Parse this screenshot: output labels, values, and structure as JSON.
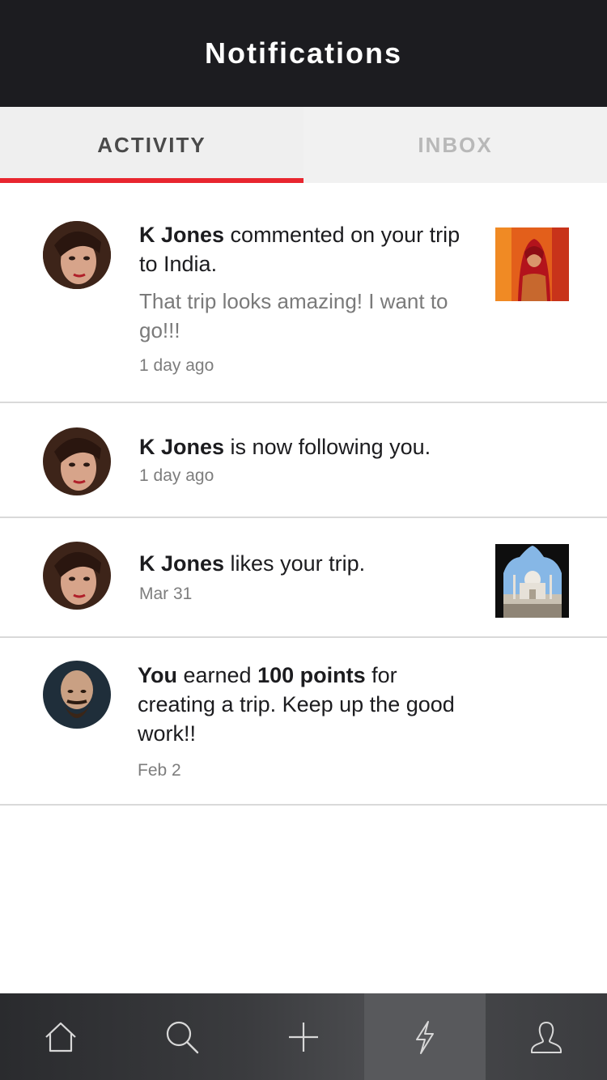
{
  "header": {
    "title": "Notifications"
  },
  "tabs": [
    {
      "label": "ACTIVITY",
      "active": true
    },
    {
      "label": "INBOX",
      "active": false
    }
  ],
  "accent_color": "#e8262f",
  "notifications": [
    {
      "actor": "K Jones",
      "action": " commented on your trip to India.",
      "comment": "That trip looks amazing! I want to go!!!",
      "time": "1 day ago",
      "avatar": "woman-avatar",
      "thumbnail": "india-bride-thumbnail"
    },
    {
      "actor": "K Jones",
      "action": " is now following you.",
      "time": "1 day ago",
      "avatar": "woman-avatar"
    },
    {
      "actor": "K Jones",
      "action": " likes your trip.",
      "time": "Mar 31",
      "avatar": "woman-avatar",
      "thumbnail": "taj-mahal-thumbnail"
    },
    {
      "actor": "You",
      "action_prefix": " earned ",
      "points": "100 points",
      "action_suffix": " for creating a trip. Keep up the good work!!",
      "time": "Feb 2",
      "avatar": "bearded-man-avatar"
    }
  ],
  "tabbar": {
    "items": [
      {
        "icon": "home-icon"
      },
      {
        "icon": "search-icon"
      },
      {
        "icon": "plus-icon"
      },
      {
        "icon": "lightning-icon",
        "selected": true
      },
      {
        "icon": "profile-icon"
      }
    ]
  }
}
